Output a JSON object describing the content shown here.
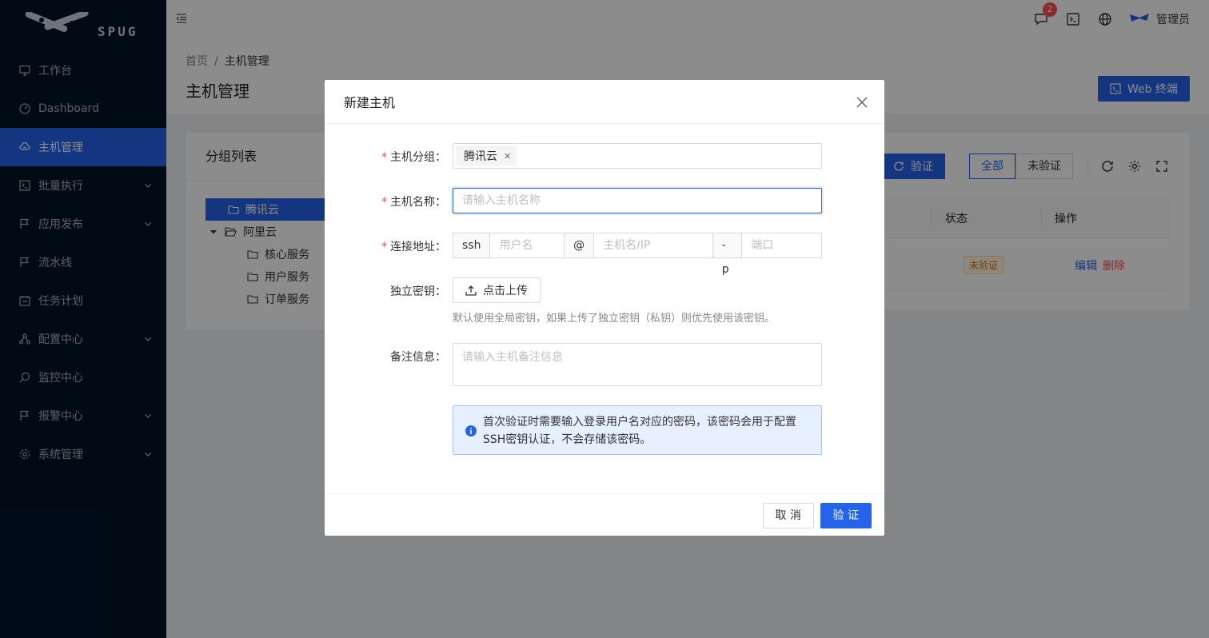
{
  "app": {
    "logo_text": "SPUG"
  },
  "sidebar": {
    "items": [
      {
        "label": "工作台",
        "icon": "desktop-icon",
        "arrow": false,
        "active": false
      },
      {
        "label": "Dashboard",
        "icon": "dashboard-icon",
        "arrow": false,
        "active": false
      },
      {
        "label": "主机管理",
        "icon": "cloud-server-icon",
        "arrow": false,
        "active": true
      },
      {
        "label": "批量执行",
        "icon": "terminal-icon",
        "arrow": true,
        "active": false
      },
      {
        "label": "应用发布",
        "icon": "flag-icon",
        "arrow": true,
        "active": false
      },
      {
        "label": "流水线",
        "icon": "flag-icon",
        "arrow": false,
        "active": false
      },
      {
        "label": "任务计划",
        "icon": "schedule-icon",
        "arrow": false,
        "active": false
      },
      {
        "label": "配置中心",
        "icon": "deployment-unit-icon",
        "arrow": true,
        "active": false
      },
      {
        "label": "监控中心",
        "icon": "monitor-icon",
        "arrow": false,
        "active": false
      },
      {
        "label": "报警中心",
        "icon": "alert-icon",
        "arrow": true,
        "active": false
      },
      {
        "label": "系统管理",
        "icon": "setting-icon",
        "arrow": true,
        "active": false
      }
    ]
  },
  "header": {
    "notification_count": "2",
    "user_name": "管理员"
  },
  "breadcrumb": {
    "home": "首页",
    "separator": "/",
    "current": "主机管理"
  },
  "page": {
    "title": "主机管理",
    "web_terminal_label": "Web 终端"
  },
  "group_panel": {
    "title": "分组列表",
    "nodes": [
      {
        "label": "腾讯云"
      },
      {
        "label": "阿里云"
      },
      {
        "label": "核心服务"
      },
      {
        "label": "用户服务"
      },
      {
        "label": "订单服务"
      }
    ]
  },
  "host_panel": {
    "verify_label": "验证",
    "filter_all": "全部",
    "filter_unverified": "未验证",
    "col_status": "状态",
    "col_actions": "操作",
    "row_status": "未验证",
    "row_edit": "编辑",
    "row_delete": "删除"
  },
  "modal": {
    "title": "新建主机",
    "group_label": "主机分组",
    "group_value": "腾讯云",
    "name_label": "主机名称",
    "name_placeholder": "请输入主机名称",
    "address_label": "连接地址",
    "addr_prefix": "ssh",
    "addr_user_placeholder": "用户名",
    "addr_at": "@",
    "addr_host_placeholder": "主机名/IP",
    "addr_port_prefix": "-p",
    "addr_port_placeholder": "端口",
    "key_label": "独立密钥",
    "upload_label": "点击上传",
    "key_help": "默认使用全局密钥，如果上传了独立密钥（私钥）则优先使用该密钥。",
    "note_label": "备注信息",
    "note_placeholder": "请输入主机备注信息",
    "alert_line1": "首次验证时需要输入登录用户名对应的密码，该密码会用于配置",
    "alert_line2": "SSH密钥认证，不会存储该密码。",
    "cancel_label": "取 消",
    "ok_label": "验 证",
    "colon": "："
  }
}
